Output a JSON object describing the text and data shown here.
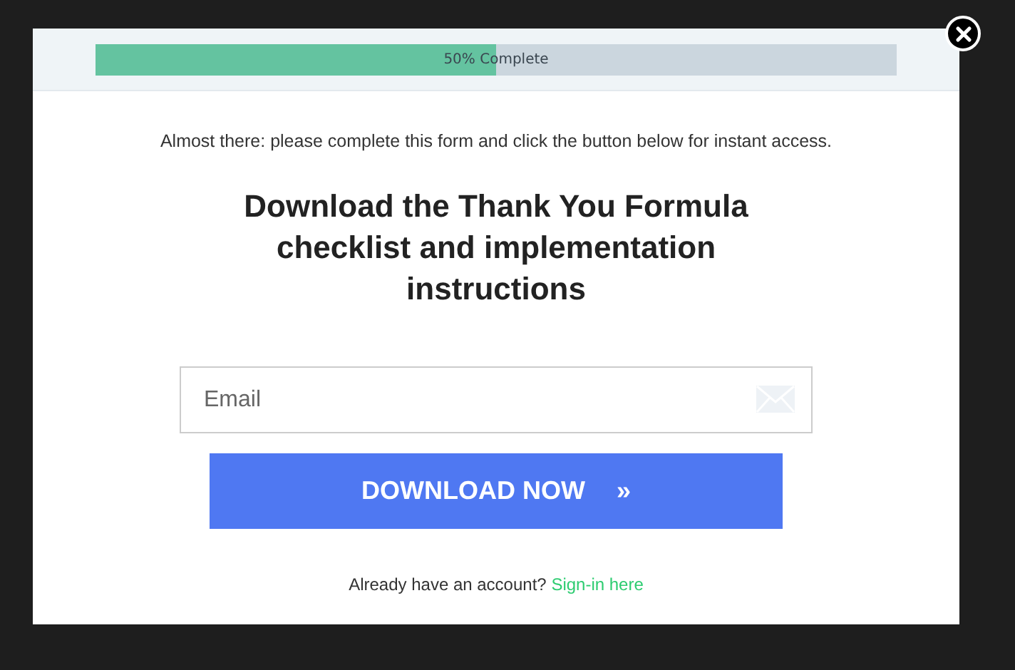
{
  "progress": {
    "level": 0.5,
    "label": "50% Complete"
  },
  "intro": "Almost there: please complete this form and click the button below for instant access.",
  "heading": "Download the Thank You Formula checklist and implementation instructions",
  "email_field": {
    "placeholder": "Email"
  },
  "button": {
    "label": "DOWNLOAD NOW",
    "arrow": "»"
  },
  "footer": {
    "text": "Already have an account?",
    "link": "Sign-in here"
  }
}
